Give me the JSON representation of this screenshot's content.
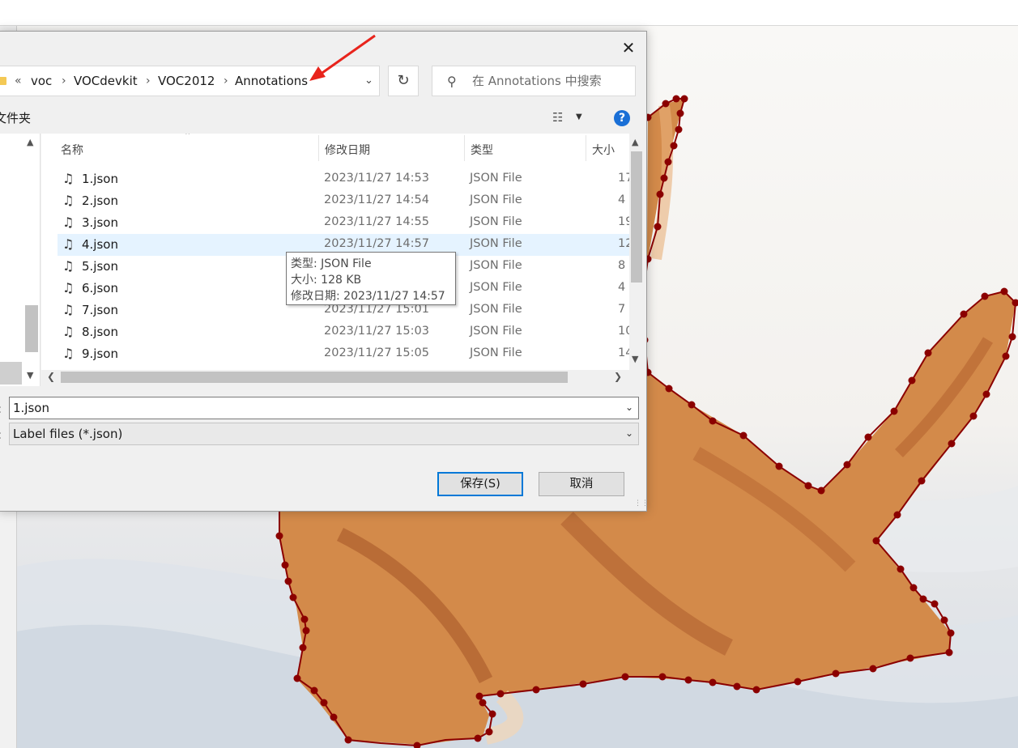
{
  "dialog": {
    "close_label": "✕",
    "breadcrumb": {
      "overflow": "«",
      "items": [
        "voc",
        "VOCdevkit",
        "VOC2012",
        "Annotations"
      ],
      "separator": "›"
    },
    "search_placeholder": "在 Annotations 中搜索",
    "new_folder_label": "文件夹",
    "columns": {
      "name": "名称",
      "date": "修改日期",
      "type": "类型",
      "size": "大小"
    },
    "files": [
      {
        "name": "1.json",
        "date": "2023/11/27 14:53",
        "type": "JSON File",
        "size": "17"
      },
      {
        "name": "2.json",
        "date": "2023/11/27 14:54",
        "type": "JSON File",
        "size": "4"
      },
      {
        "name": "3.json",
        "date": "2023/11/27 14:55",
        "type": "JSON File",
        "size": "19"
      },
      {
        "name": "4.json",
        "date": "2023/11/27 14:57",
        "type": "JSON File",
        "size": "12"
      },
      {
        "name": "5.json",
        "date": "",
        "type": "JSON File",
        "size": "8"
      },
      {
        "name": "6.json",
        "date": "",
        "type": "JSON File",
        "size": "4"
      },
      {
        "name": "7.json",
        "date": "2023/11/27 15:01",
        "type": "JSON File",
        "size": "7"
      },
      {
        "name": "8.json",
        "date": "2023/11/27 15:03",
        "type": "JSON File",
        "size": "10"
      },
      {
        "name": "9.json",
        "date": "2023/11/27 15:05",
        "type": "JSON File",
        "size": "14"
      }
    ],
    "tooltip": {
      "type_line": "类型: JSON File",
      "size_line": "大小: 128 KB",
      "date_line": "修改日期: 2023/11/27 14:57"
    },
    "filename_label": ":",
    "filename_value": "1.json",
    "filetype_label": ":",
    "filetype_value": "Label files (*.json)",
    "save_button": "保存(S)",
    "cancel_button": "取消",
    "help_label": "?"
  },
  "colors": {
    "polygon": "#8b0000",
    "accent": "#0078d7",
    "hover_row": "#e5f3ff",
    "arrow": "#e8241c"
  }
}
